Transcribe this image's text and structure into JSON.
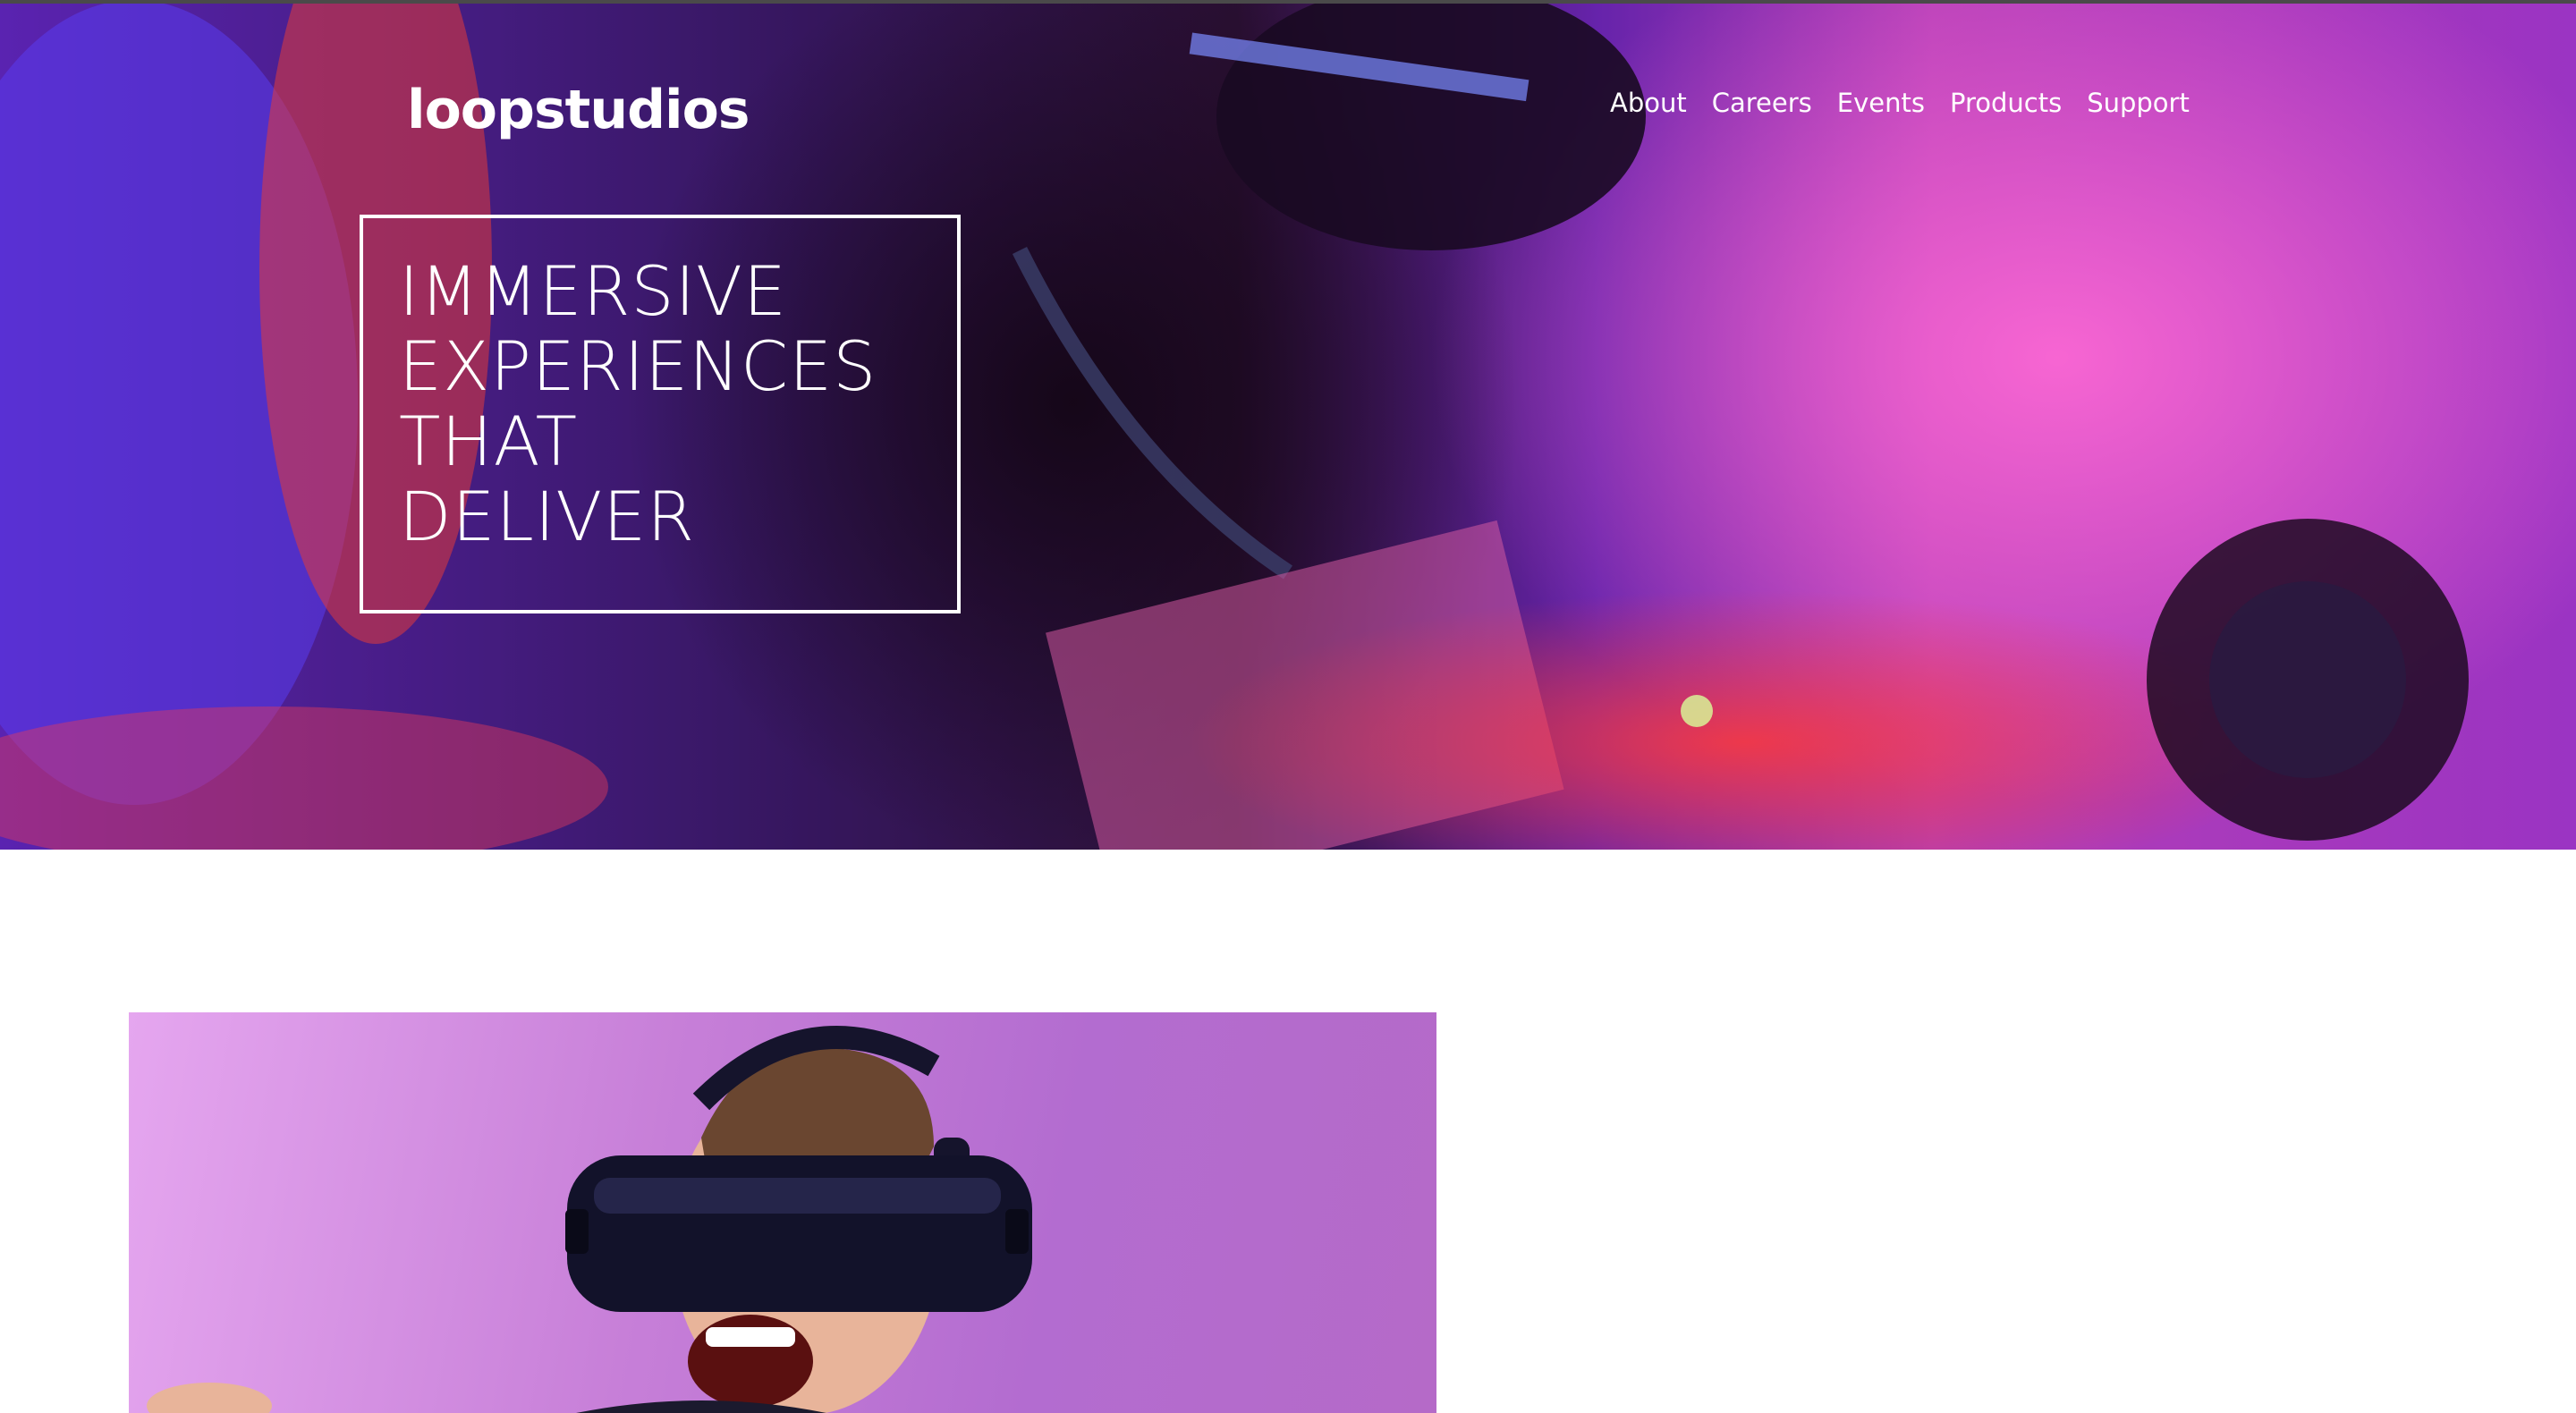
{
  "header": {
    "logo": "loopstudios",
    "nav": [
      {
        "label": "About"
      },
      {
        "label": "Careers"
      },
      {
        "label": "Events"
      },
      {
        "label": "Products"
      },
      {
        "label": "Support"
      }
    ]
  },
  "hero": {
    "headline_lines": [
      "IMMERSIVE",
      "EXPERIENCES",
      "THAT",
      "DELIVER"
    ]
  },
  "colors": {
    "text_on_image": "#ffffff",
    "page_background": "#ffffff",
    "hero_magenta": "#e04ee0",
    "hero_violet": "#6a2ad8",
    "feature_lilac": "#c77fd8"
  },
  "icons": {
    "hero_image": "vr-headset-person-photo",
    "feature_image": "man-wearing-vr-headset-photo"
  }
}
